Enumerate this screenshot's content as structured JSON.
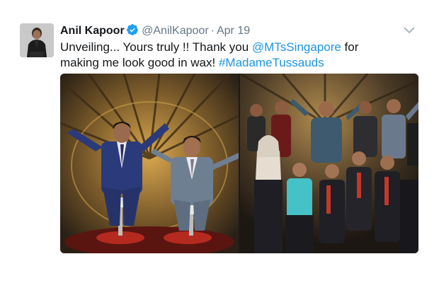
{
  "tweet": {
    "display_name": "Anil Kapoor",
    "handle": "@AnilKapoor",
    "separator": "·",
    "timestamp": "Apr 19",
    "text": {
      "part1": "Unveiling... Yours truly !! Thank you ",
      "mention": "@MTsSingapore",
      "part2": " for making me look good in wax! ",
      "hashtag": "#MadameTussauds"
    },
    "icons": {
      "verified": "verified-badge-icon",
      "menu": "chevron-down-icon"
    },
    "colors": {
      "link": "#1b95e0",
      "verified": "#1da1f2",
      "secondary_text": "#657786",
      "primary_text": "#14171a"
    }
  }
}
